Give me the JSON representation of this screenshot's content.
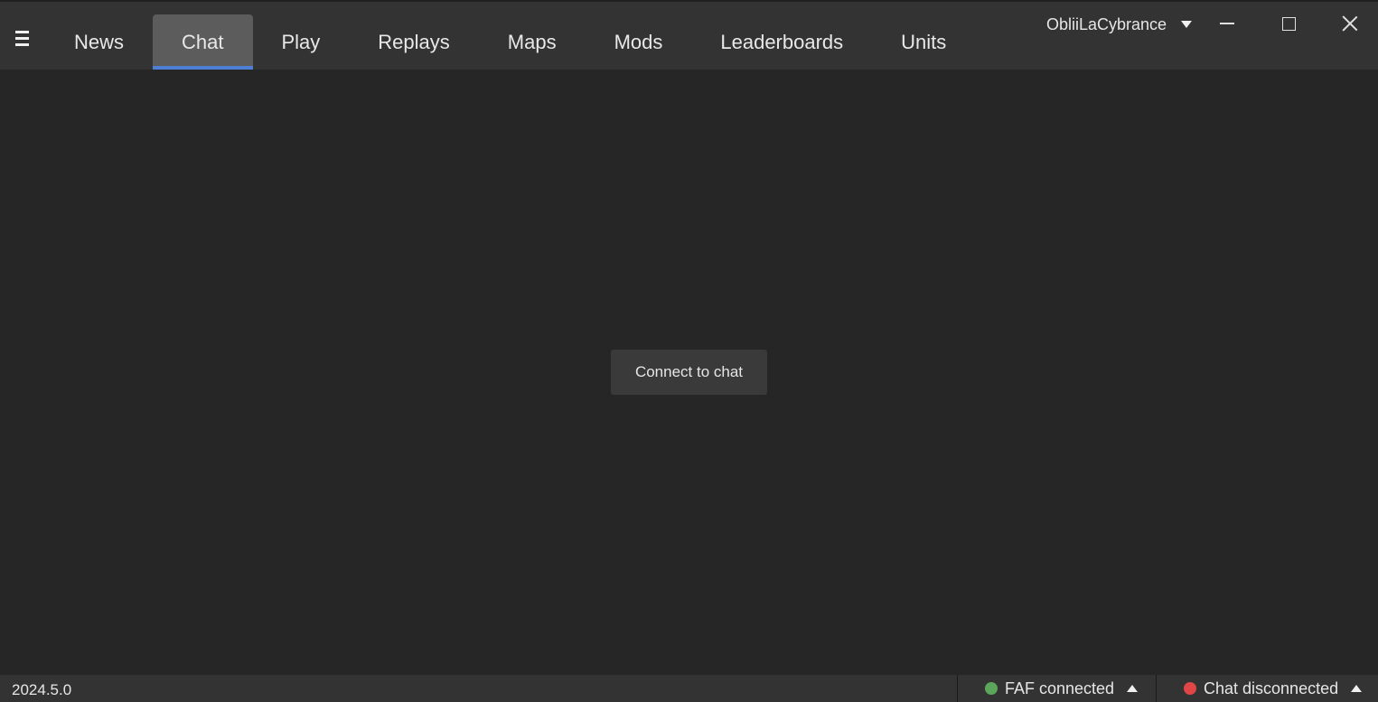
{
  "header": {
    "menu_icon": "hamburger-icon",
    "tabs": [
      {
        "label": "News",
        "active": false
      },
      {
        "label": "Chat",
        "active": true
      },
      {
        "label": "Play",
        "active": false
      },
      {
        "label": "Replays",
        "active": false
      },
      {
        "label": "Maps",
        "active": false
      },
      {
        "label": "Mods",
        "active": false
      },
      {
        "label": "Leaderboards",
        "active": false
      },
      {
        "label": "Units",
        "active": false
      }
    ],
    "username": "ObliiLaCybrance",
    "active_tab_accent": "#4d7fd4"
  },
  "main": {
    "connect_button_label": "Connect to chat"
  },
  "statusbar": {
    "version": "2024.5.0",
    "faf_status": {
      "label": "FAF connected",
      "color": "#5ba65b"
    },
    "chat_status": {
      "label": "Chat disconnected",
      "color": "#e04646"
    }
  }
}
